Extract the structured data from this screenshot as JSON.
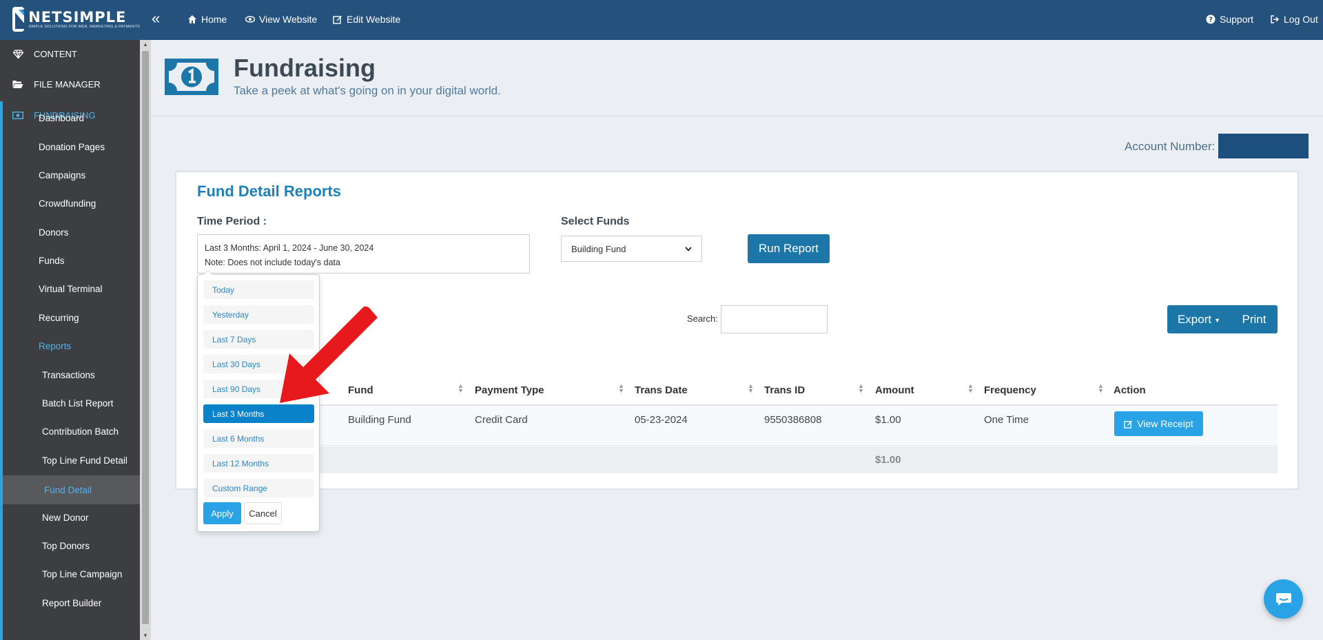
{
  "brand": {
    "name": "NETSIMPLE",
    "tagline": "SIMPLE SOLUTIONS FOR WEB, MARKETING & PAYMENTS"
  },
  "topnav": {
    "collapse": "«",
    "home": "Home",
    "view_website": "View Website",
    "edit_website": "Edit Website",
    "support": "Support",
    "logout": "Log Out"
  },
  "sidebar": {
    "sections": [
      {
        "label": "CONTENT",
        "icon": "diamond-icon"
      },
      {
        "label": "FILE MANAGER",
        "icon": "folder-open-icon"
      },
      {
        "label": "FUNDRAISING",
        "icon": "money-icon"
      }
    ],
    "items": [
      "Dashboard",
      "Donation Pages",
      "Campaigns",
      "Crowdfunding",
      "Donors",
      "Funds",
      "Virtual Terminal",
      "Recurring",
      "Reports"
    ],
    "report_items": [
      "Transactions",
      "Batch List Report",
      "Contribution Batch",
      "Top Line Fund Detail",
      "Fund Detail",
      "New Donor",
      "Top Donors",
      "Top Line Campaign",
      "Report Builder"
    ],
    "selected": "Fund Detail"
  },
  "header": {
    "title": "Fundraising",
    "subtitle": "Take a peek at what's going on in your digital world."
  },
  "account": {
    "label": "Account Number:"
  },
  "report": {
    "title": "Fund Detail Reports",
    "time_period_label": "Time Period :",
    "period_line1": "Last 3 Months: April 1, 2024 - June 30, 2024",
    "period_line2": "Note: Does not include today's data",
    "select_funds_label": "Select Funds",
    "selected_fund": "Building Fund",
    "run_button": "Run Report",
    "search_label": "Search:",
    "export_button": "Export",
    "print_button": "Print"
  },
  "table": {
    "columns": [
      "Fund",
      "Payment Type",
      "Trans Date",
      "Trans ID",
      "Amount",
      "Frequency",
      "Action"
    ],
    "rows": [
      {
        "fund": "Building Fund",
        "payment_type": "Credit Card",
        "trans_date": "05-23-2024",
        "trans_id": "9550386808",
        "amount": "$1.00",
        "frequency": "One Time",
        "action": "View Receipt"
      }
    ],
    "total": "$1.00"
  },
  "date_picker": {
    "ranges": [
      "Today",
      "Yesterday",
      "Last 7 Days",
      "Last 30 Days",
      "Last 90 Days",
      "Last 3 Months",
      "Last 6 Months",
      "Last 12 Months",
      "Custom Range"
    ],
    "active": "Last 3 Months",
    "apply": "Apply",
    "cancel": "Cancel"
  },
  "colors": {
    "topbar": "#25527c",
    "sidebar": "#3d3e42",
    "accent": "#2aa3e6",
    "primary_button": "#1d76a8",
    "arrow": "#e8191c"
  }
}
